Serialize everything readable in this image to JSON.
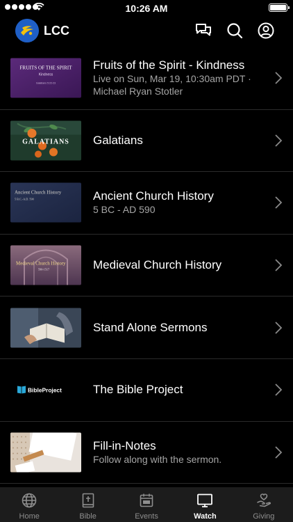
{
  "status_bar": {
    "time": "10:26 AM",
    "battery_level": 1.0
  },
  "header": {
    "title": "LCC",
    "icons": [
      "chat-icon",
      "search-icon",
      "profile-icon"
    ]
  },
  "thumbnails": {
    "fruits": {
      "title": "FRUITS OF THE SPIRIT",
      "subtitle": "Kindness",
      "ref": "Galatians 5:22-23"
    },
    "galatians": {
      "title": "GALATIANS"
    },
    "ancient": {
      "title": "Ancient Church History",
      "sub": "5 B.C.-A.D. 590"
    },
    "medieval": {
      "title": "Medieval Church History",
      "sub": "590-1517"
    },
    "bibleproject": {
      "title": "BibleProject"
    }
  },
  "list": [
    {
      "title": "Fruits of the Spirit - Kindness",
      "subtitle": "Live on Sun, Mar 19, 10:30am PDT · Michael Ryan Stotler"
    },
    {
      "title": "Galatians",
      "subtitle": ""
    },
    {
      "title": "Ancient Church History",
      "subtitle": "5 BC - AD 590"
    },
    {
      "title": "Medieval Church History",
      "subtitle": ""
    },
    {
      "title": "Stand Alone Sermons",
      "subtitle": ""
    },
    {
      "title": "The Bible Project",
      "subtitle": ""
    },
    {
      "title": "Fill-in-Notes",
      "subtitle": "Follow along with the sermon."
    }
  ],
  "tabs": [
    {
      "label": "Home",
      "icon": "globe-icon",
      "active": false
    },
    {
      "label": "Bible",
      "icon": "bible-icon",
      "active": false
    },
    {
      "label": "Events",
      "icon": "calendar-icon",
      "active": false
    },
    {
      "label": "Watch",
      "icon": "tv-icon",
      "active": true
    },
    {
      "label": "Giving",
      "icon": "heart-hand-icon",
      "active": false
    }
  ],
  "colors": {
    "background": "#000000",
    "tab_bar": "#1c1c1c",
    "accent": "#1f5fc6",
    "subtitle": "#a6a6a6"
  }
}
